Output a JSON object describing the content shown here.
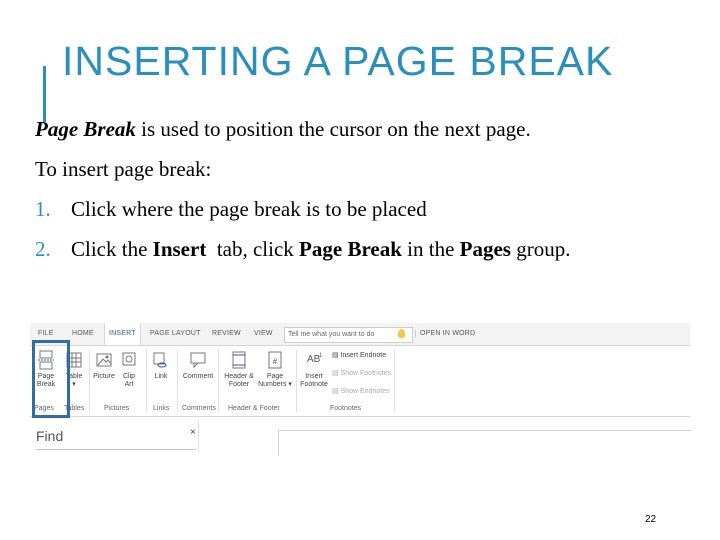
{
  "slide": {
    "title": "INSERTING A PAGE BREAK",
    "line1": {
      "term": "Page Break",
      "rest": " is used to position the cursor on the next page."
    },
    "line2": "To insert page break:",
    "steps": [
      {
        "num": "1.",
        "text": "Click where the page break is to be placed"
      },
      {
        "num": "2.",
        "pre": "Click the ",
        "insert": "Insert",
        "mid": "  tab, click ",
        "page_break": "Page Break",
        "mid2": " in the ",
        "pages": "Pages",
        "post": " group."
      }
    ],
    "page_number": "22",
    "accent_color": "#2a8fbd"
  },
  "ribbon": {
    "tabs": [
      "FILE",
      "HOME",
      "INSERT",
      "PAGE LAYOUT",
      "REVIEW",
      "VIEW"
    ],
    "active_tab": "INSERT",
    "tell_me_placeholder": "Tell me what you want to do",
    "open_in_word": "OPEN IN WORD",
    "commands": {
      "page_break": [
        "Page",
        "Break"
      ],
      "table": "Table",
      "picture": "Picture",
      "clip_art": [
        "Clip",
        "Art"
      ],
      "link": "Link",
      "comment": "Comment",
      "header_footer": [
        "Header &",
        "Footer"
      ],
      "page_numbers": [
        "Page",
        "Numbers ▾"
      ],
      "insert_footnote": [
        "Insert",
        "Footnote"
      ],
      "insert_endnote": "Insert Endnote",
      "show_footnotes": "Show Footnotes",
      "show_endnotes": "Show Endnotes"
    },
    "groups": {
      "pages": "Pages",
      "tables": "Tables",
      "pictures": "Pictures",
      "links": "Links",
      "comments": "Comments",
      "header_footer": "Header & Footer",
      "footnotes": "Footnotes"
    },
    "find_label": "Find",
    "find_close": "×",
    "highlight_color": "#2f6da3"
  }
}
